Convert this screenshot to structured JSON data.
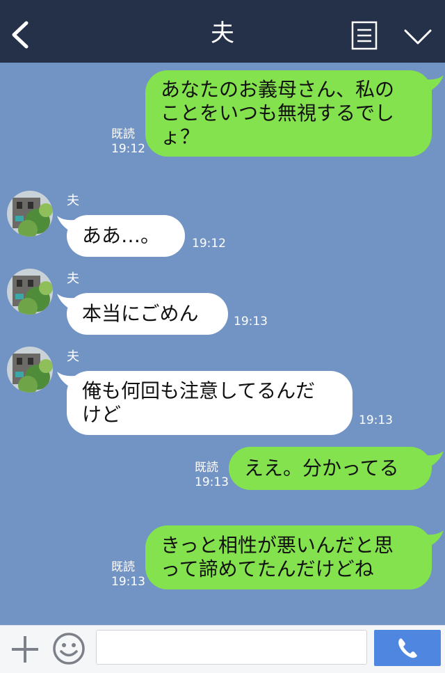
{
  "header": {
    "title": "夫"
  },
  "messages": [
    {
      "direction": "outgoing",
      "text": "あなたのお義母さん、私の\nことをいつも無視するでし\nょ？",
      "read_label": "既読",
      "time": "19:12"
    },
    {
      "direction": "incoming",
      "sender": "夫",
      "text": "ああ…。",
      "time": "19:12"
    },
    {
      "direction": "incoming",
      "sender": "夫",
      "text": "本当にごめん",
      "time": "19:13"
    },
    {
      "direction": "incoming",
      "sender": "夫",
      "text": "俺も何回も注意してるんだ\nけど",
      "time": "19:13"
    },
    {
      "direction": "outgoing",
      "text": "ええ。分かってる",
      "read_label": "既読",
      "time": "19:13"
    },
    {
      "direction": "outgoing",
      "text": "きっと相性が悪いんだと思\nって諦めてたんだけどね",
      "read_label": "既読",
      "time": "19:13"
    }
  ],
  "composer": {
    "input_value": ""
  },
  "icons": {
    "back": "back-arrow-icon",
    "menu": "menu-list-icon",
    "collapse": "chevron-down-icon",
    "add": "plus-icon",
    "sticker": "smile-icon",
    "call": "phone-icon"
  },
  "colors": {
    "background": "#7294c4",
    "header": "#253049",
    "outgoing_bubble": "#83e24d",
    "incoming_bubble": "#ffffff",
    "call_button": "#4e86e0"
  }
}
